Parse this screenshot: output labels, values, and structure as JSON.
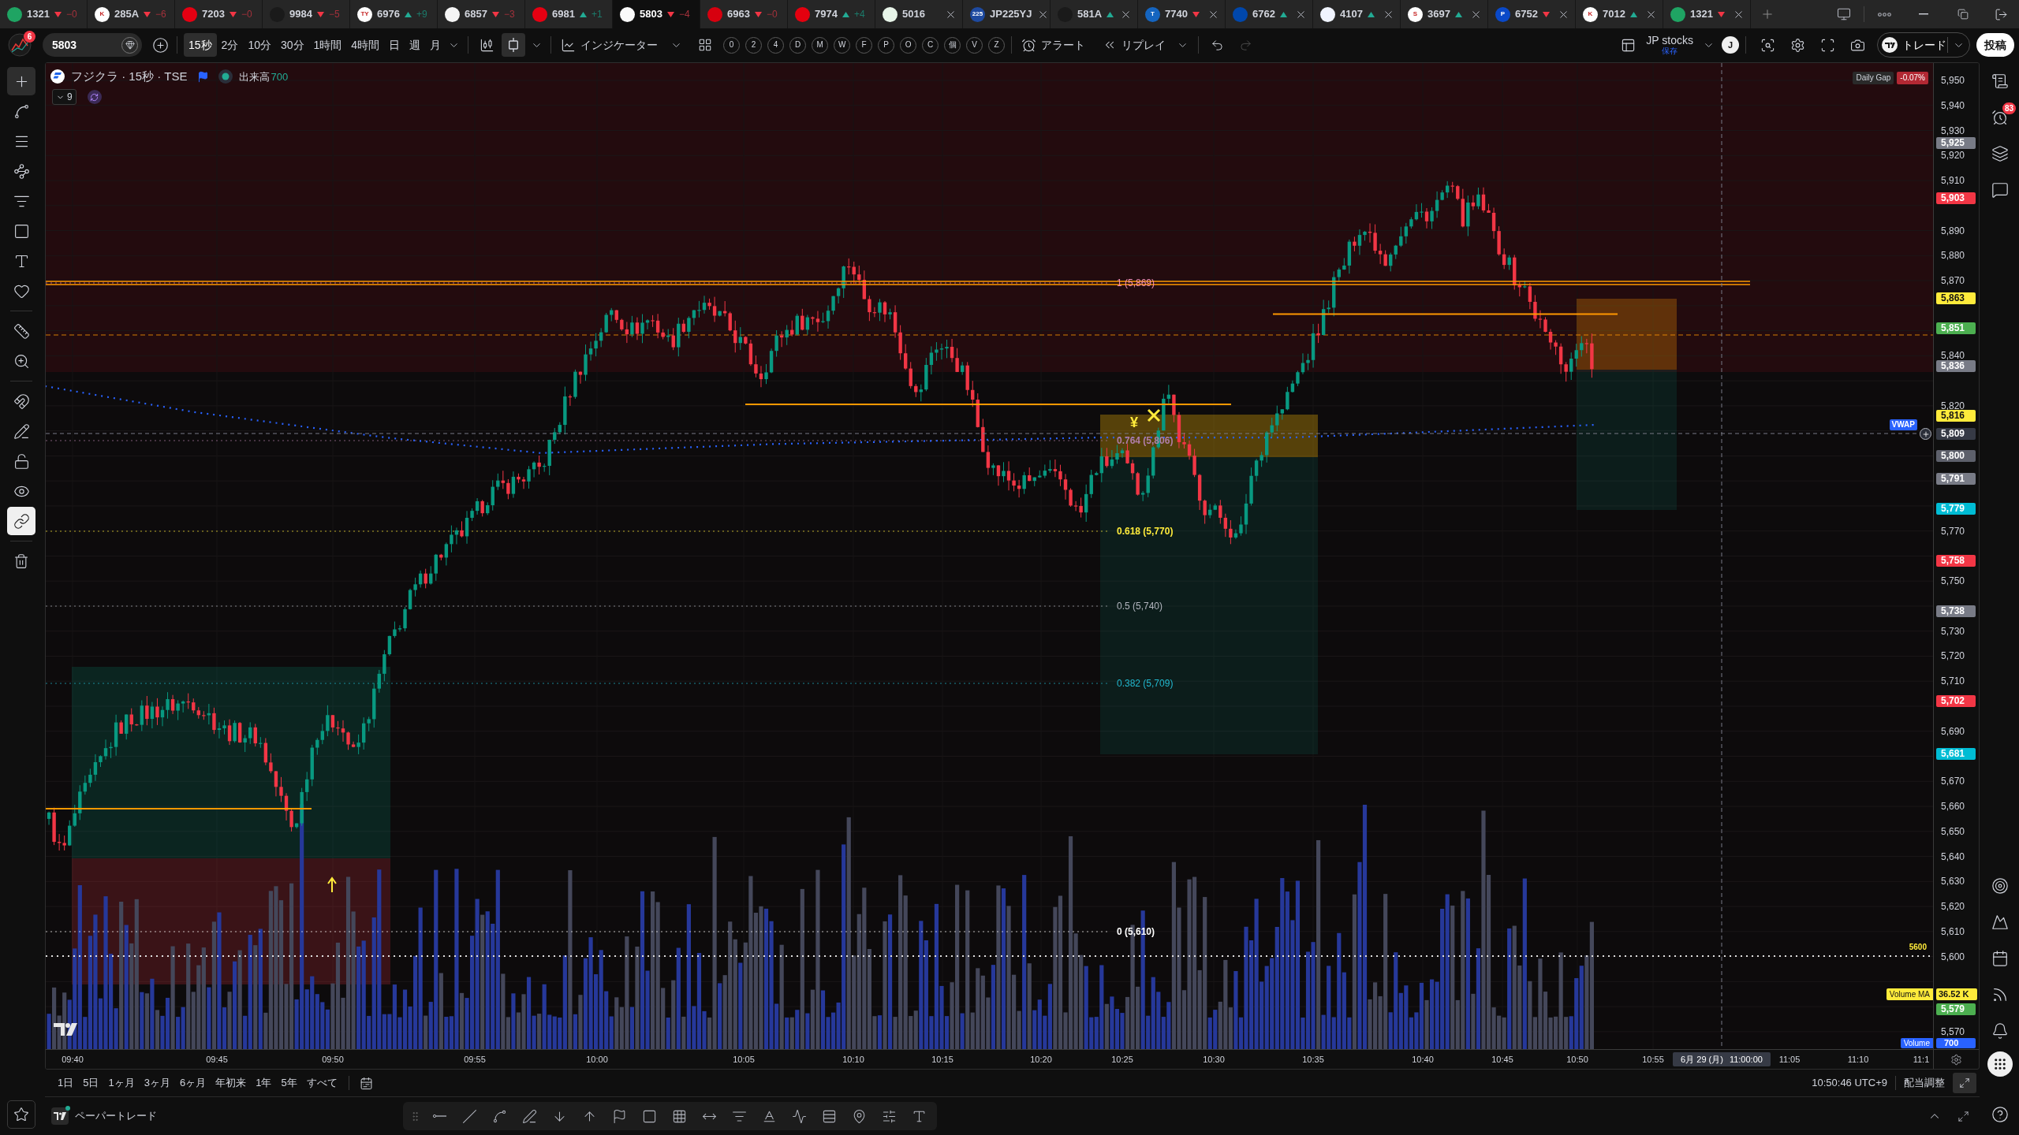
{
  "tabs": [
    {
      "ticker": "1321",
      "color": "#1fa463",
      "kind": "down",
      "change": "−0",
      "closable": false,
      "selected": false
    },
    {
      "ticker": "285A",
      "color": "#ffffff",
      "logo_text": "K",
      "kind": "down",
      "change": "−6",
      "closable": false,
      "selected": false
    },
    {
      "ticker": "7203",
      "color": "#e60012",
      "kind": "down",
      "change": "−0",
      "closable": false,
      "selected": false
    },
    {
      "ticker": "9984",
      "color": "#1a1a1a",
      "kind": "down",
      "change": "−5",
      "closable": false,
      "selected": false
    },
    {
      "ticker": "6976",
      "color": "#ffffff",
      "logo_text": "TY",
      "kind": "up",
      "change": "+9",
      "closable": false,
      "selected": false
    },
    {
      "ticker": "6857",
      "color": "#f5f5f5",
      "kind": "down",
      "change": "−3",
      "closable": false,
      "selected": false
    },
    {
      "ticker": "6981",
      "color": "#e60012",
      "kind": "up",
      "change": "+1",
      "closable": false,
      "selected": false
    },
    {
      "ticker": "5803",
      "color": "#fafafa",
      "kind": "down",
      "change": "−4",
      "closable": false,
      "selected": true
    },
    {
      "ticker": "6963",
      "color": "#d7000f",
      "kind": "down",
      "change": "−0",
      "closable": false,
      "selected": false
    },
    {
      "ticker": "7974",
      "color": "#e4000f",
      "kind": "up",
      "change": "+4",
      "closable": false,
      "selected": false
    },
    {
      "ticker": "5016",
      "color": "#e8f5e9",
      "kind": "plain",
      "closable": true,
      "selected": false
    },
    {
      "ticker": "JP225YJ",
      "color": "#1e4aa0",
      "logo_text": "225",
      "kind": "plain",
      "closable": true,
      "selected": false
    },
    {
      "ticker": "581A",
      "color": "#1a1a1a",
      "kind": "up",
      "closable": true,
      "selected": false
    },
    {
      "ticker": "7740",
      "color": "#1565c0",
      "logo_text": "T",
      "kind": "down",
      "closable": true,
      "selected": false
    },
    {
      "ticker": "6762",
      "color": "#0047ab",
      "kind": "up",
      "closable": true,
      "selected": false
    },
    {
      "ticker": "4107",
      "color": "#f0f4ff",
      "kind": "up",
      "closable": true,
      "selected": false
    },
    {
      "ticker": "3697",
      "color": "#ffffff",
      "logo_text": "S",
      "kind": "up",
      "closable": true,
      "selected": false
    },
    {
      "ticker": "6752",
      "color": "#0a49c8",
      "logo_text": "P",
      "kind": "down",
      "closable": true,
      "selected": false
    },
    {
      "ticker": "7012",
      "color": "#ffffff",
      "logo_text": "K",
      "kind": "up",
      "closable": true,
      "selected": false
    },
    {
      "ticker": "1321",
      "color": "#1fa463",
      "kind": "down",
      "closable": true,
      "selected": false
    }
  ],
  "toolbar": {
    "notification_count": "6",
    "symbol": "5803",
    "intervals": [
      {
        "label": "15秒",
        "selected": true
      },
      {
        "label": "2分",
        "selected": false
      },
      {
        "label": "10分",
        "selected": false
      },
      {
        "label": "30分",
        "selected": false
      },
      {
        "label": "1時間",
        "selected": false
      },
      {
        "label": "4時間",
        "selected": false
      },
      {
        "label": "日",
        "selected": false
      },
      {
        "label": "週",
        "selected": false
      },
      {
        "label": "月",
        "selected": false
      }
    ],
    "chart_types": [
      {
        "kind": "candles",
        "selected": false
      },
      {
        "kind": "hollow-candles",
        "selected": true
      }
    ],
    "indicators_label": "インジケーター",
    "quick_buttons": [
      "0",
      "2",
      "4",
      "D",
      "M",
      "W",
      "F",
      "P",
      "O",
      "C",
      "個",
      "V",
      "Z"
    ],
    "alert_label": "アラート",
    "replay_label": "リプレイ",
    "undo": {
      "disabled": false
    },
    "redo": {
      "disabled": true
    },
    "layout_name": "JP stocks",
    "layout_status": "保存",
    "user_initial": "J",
    "trade_label": "トレード",
    "publish_label": "投稿"
  },
  "drawing_tools": [
    {
      "kind": "crosshair",
      "selected": true
    },
    {
      "kind": "trend-line",
      "selected": false
    },
    {
      "kind": "horizontal-lines",
      "selected": false
    },
    {
      "kind": "pattern",
      "selected": false
    },
    {
      "kind": "levels",
      "selected": false
    },
    {
      "kind": "rectangle",
      "selected": false
    },
    {
      "kind": "text",
      "selected": false
    },
    {
      "kind": "favorite",
      "selected": false
    }
  ],
  "measure_tools": [
    {
      "kind": "ruler",
      "selected": false
    },
    {
      "kind": "zoom",
      "selected": false
    }
  ],
  "toggles": [
    {
      "kind": "magnet",
      "on": false
    },
    {
      "kind": "draw-lock",
      "on": false
    },
    {
      "kind": "lock",
      "on": false
    },
    {
      "kind": "eye",
      "on": false
    },
    {
      "kind": "link",
      "on": true
    }
  ],
  "chart": {
    "legend": {
      "title": "フジクラ · 15秒 · TSE",
      "volume_label": "出来高",
      "volume_value": "700",
      "collapsed_count": "9"
    },
    "daily_gap": {
      "label": "Daily Gap",
      "value": "-0.07%"
    },
    "fib_levels": [
      {
        "label": "1 (5,869)",
        "color": "#f48fb1"
      },
      {
        "label": "0.764 (5,806)",
        "color": "#b07ea8"
      },
      {
        "label": "0.618 (5,770)",
        "color": "#ffeb3b"
      },
      {
        "label": "0.5 (5,740)",
        "color": "#b2b5be"
      },
      {
        "label": "0.382 (5,709)",
        "color": "#22b8cf"
      },
      {
        "label": "0 (5,610)",
        "color": "#ffffff"
      }
    ],
    "level_label": "5600",
    "vwap_label": "VWAP",
    "marker_symbol": "¥"
  },
  "price_scale": {
    "ticks": [
      "5,950",
      "5,940",
      "5,930",
      "5,920",
      "5,910",
      "5,890",
      "5,880",
      "5,870",
      "5,840",
      "5,820",
      "5,770",
      "5,750",
      "5,730",
      "5,720",
      "5,710",
      "5,690",
      "5,670",
      "5,660",
      "5,650",
      "5,640",
      "5,630",
      "5,620",
      "5,610",
      "5,600",
      "5,570"
    ],
    "badges": [
      {
        "text": "5,925",
        "color": "#787b86"
      },
      {
        "text": "5,903",
        "color": "#f23645"
      },
      {
        "text": "5,863",
        "color": "#ffeb3b"
      },
      {
        "text": "5,851",
        "color": "#4caf50"
      },
      {
        "text": "5,836",
        "color": "#787b86"
      },
      {
        "text": "5,816",
        "color": "#ffeb3b"
      },
      {
        "text": "5,800",
        "color": "#5d606b"
      },
      {
        "text": "5,791",
        "color": "#787b86"
      },
      {
        "text": "5,779",
        "color": "#00bcd4"
      },
      {
        "text": "5,758",
        "color": "#f23645"
      },
      {
        "text": "5,738",
        "color": "#787b86"
      },
      {
        "text": "5,702",
        "color": "#f23645"
      },
      {
        "text": "5,681",
        "color": "#00bcd4"
      },
      {
        "text": "5,579",
        "color": "#4caf50"
      }
    ],
    "volume_ma": {
      "label": "Volume MA",
      "value": "36.52 K"
    },
    "volume": {
      "label": "Volume",
      "value": "700"
    }
  },
  "crosshair": {
    "price": "5,809",
    "date": "6月 29 (月)",
    "time": "11:00:00"
  },
  "time_axis": {
    "ticks": [
      "09:40",
      "09:45",
      "09:50",
      "09:55",
      "10:00",
      "10:05",
      "10:10",
      "10:15",
      "10:20",
      "10:25",
      "10:30",
      "10:35",
      "10:40",
      "10:45",
      "10:50",
      "10:55",
      "11:05",
      "11:10",
      "11:1"
    ]
  },
  "date_ranges": [
    "1日",
    "5日",
    "1ヶ月",
    "3ヶ月",
    "6ヶ月",
    "年初来",
    "1年",
    "5年",
    "すべて"
  ],
  "clock": "10:50:46 UTC+9",
  "adjust_label": "配当調整",
  "bottom_panel": {
    "title": "ペーパートレード"
  },
  "sidebar": {
    "alerts_count": "83"
  }
}
